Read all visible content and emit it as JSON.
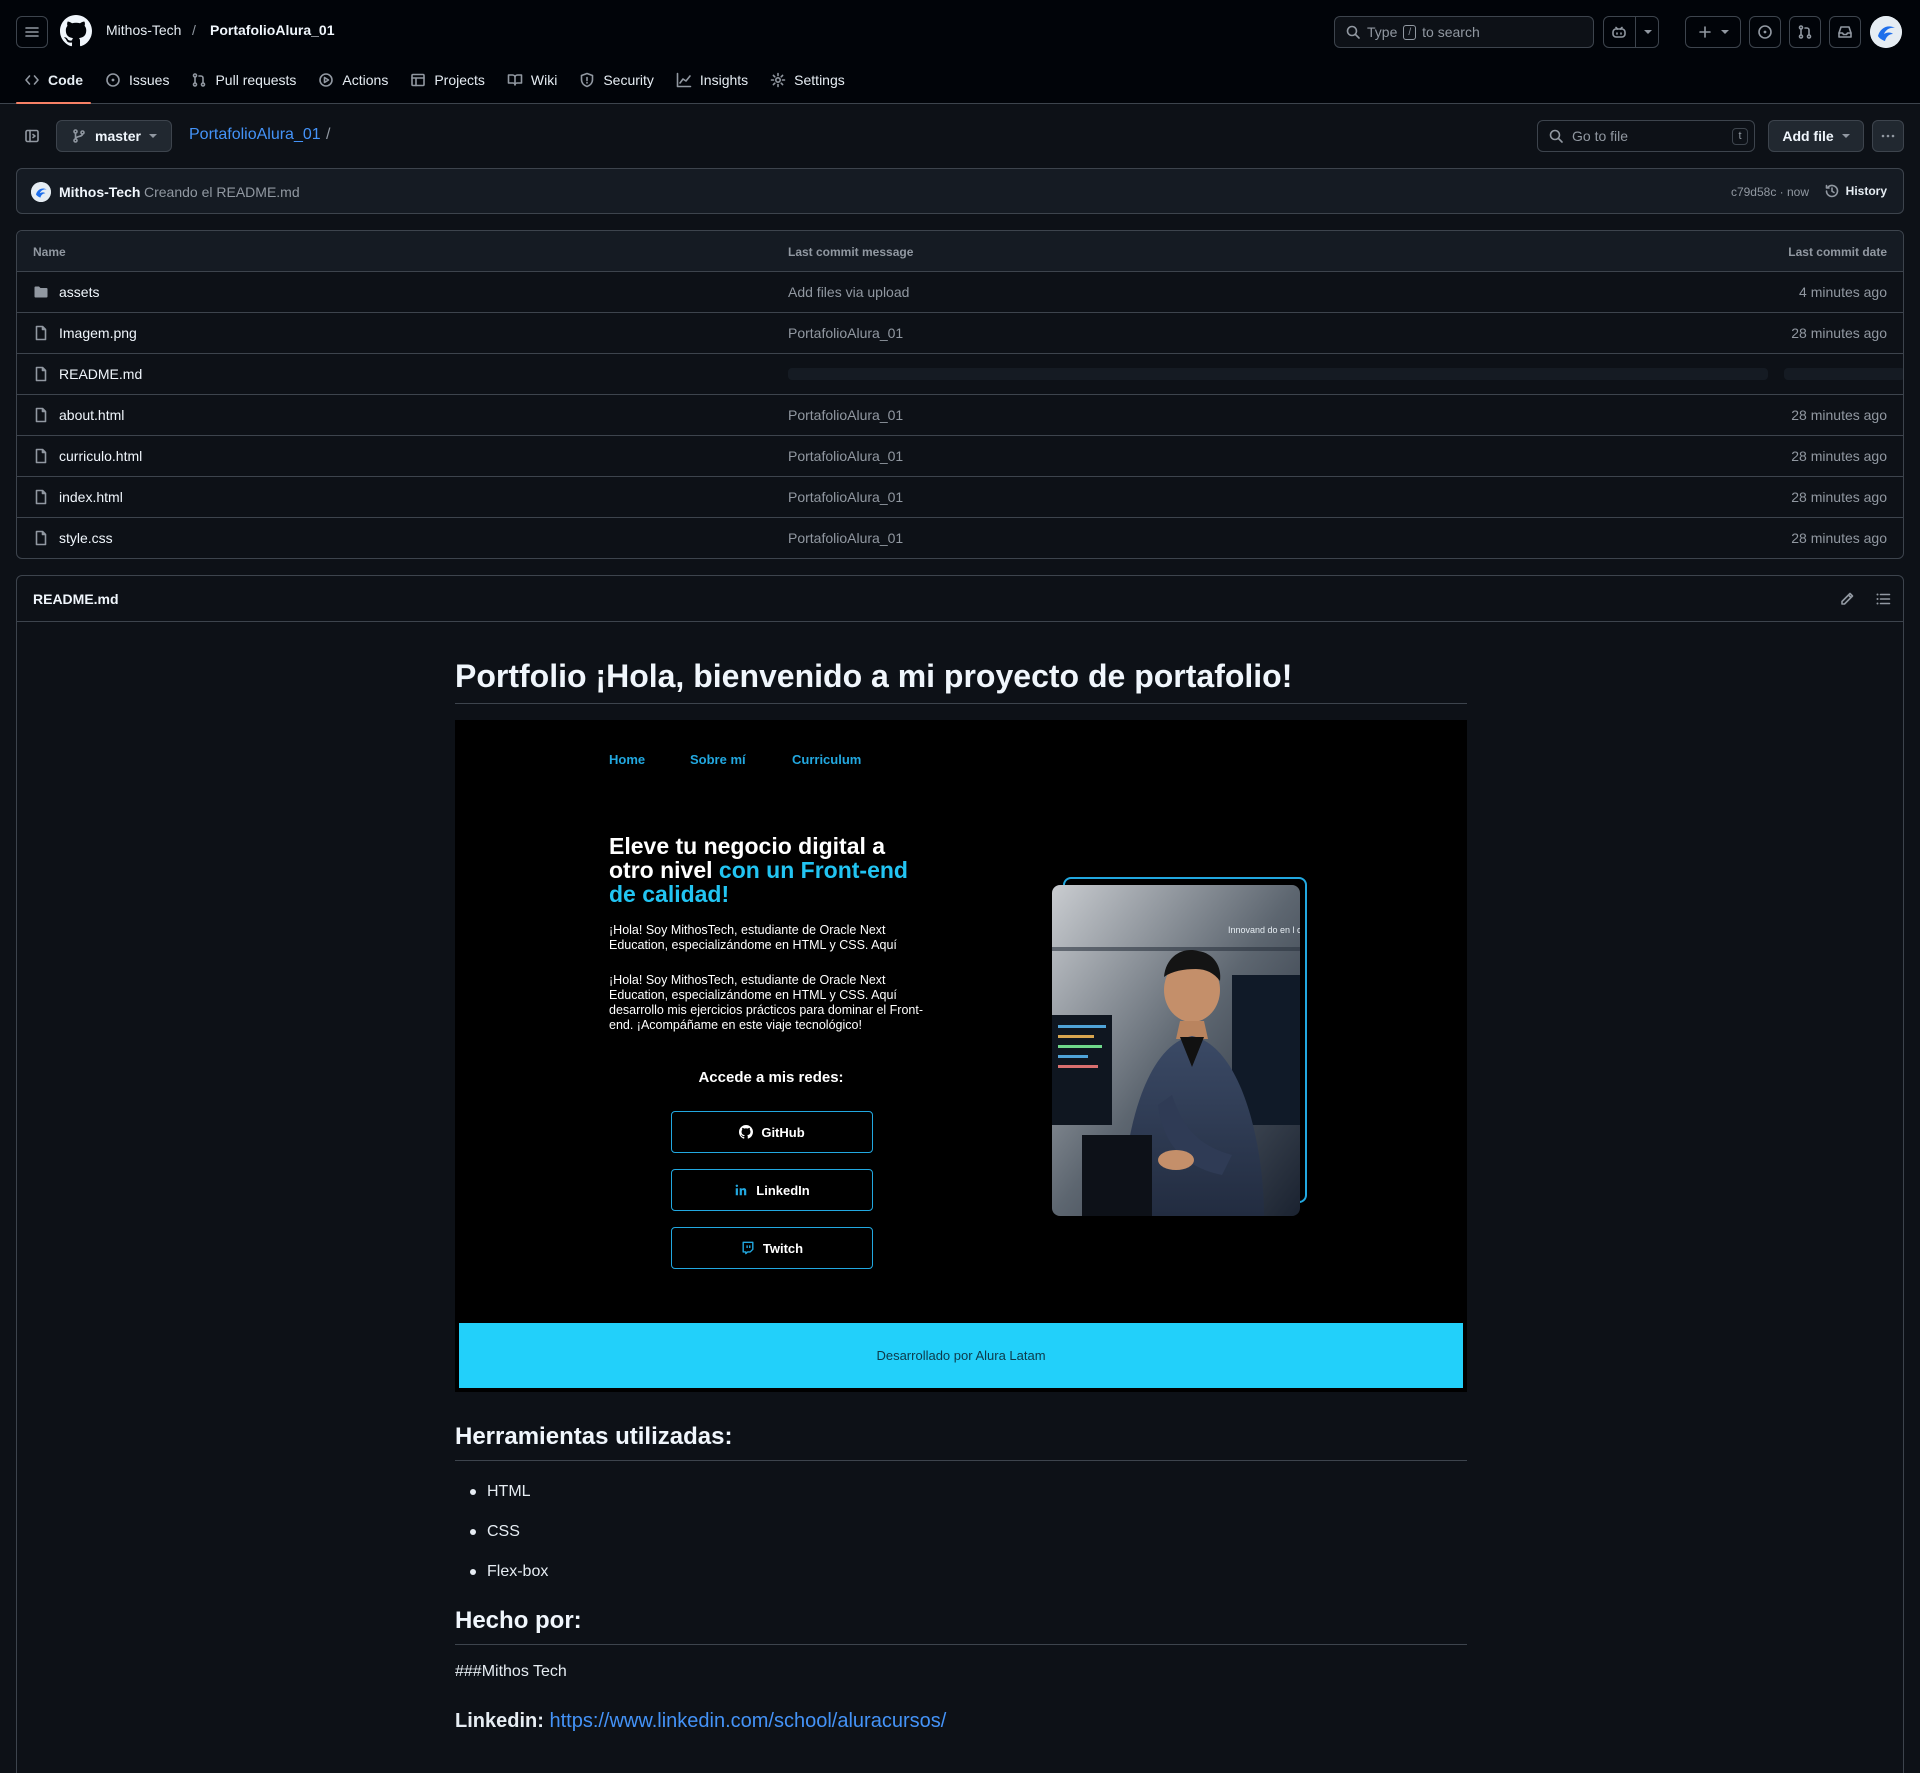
{
  "header": {
    "owner": "Mithos-Tech",
    "separator": "/",
    "repo": "PortafolioAlura_01",
    "search_before": "Type",
    "search_key": "/",
    "search_after": "to search"
  },
  "tabs": [
    {
      "label": "Code",
      "icon": "code-icon"
    },
    {
      "label": "Issues",
      "icon": "issue-icon"
    },
    {
      "label": "Pull requests",
      "icon": "pull-request-icon"
    },
    {
      "label": "Actions",
      "icon": "play-icon"
    },
    {
      "label": "Projects",
      "icon": "table-icon"
    },
    {
      "label": "Wiki",
      "icon": "book-icon"
    },
    {
      "label": "Security",
      "icon": "shield-icon"
    },
    {
      "label": "Insights",
      "icon": "graph-icon"
    },
    {
      "label": "Settings",
      "icon": "gear-icon"
    }
  ],
  "toolbar": {
    "branch": "master",
    "path_repo": "PortafolioAlura_01",
    "path_sep": "/",
    "goto_placeholder": "Go to file",
    "goto_key": "t",
    "add_file": "Add file"
  },
  "latest_commit": {
    "user": "Mithos-Tech",
    "message": "Creando el README.md",
    "hash_time": "c79d58c · now",
    "history": "History"
  },
  "files": {
    "headers": {
      "name": "Name",
      "message": "Last commit message",
      "date": "Last commit date"
    },
    "rows": [
      {
        "type": "folder",
        "name": "assets",
        "message": "Add files via upload",
        "date": "4 minutes ago"
      },
      {
        "type": "file",
        "name": "Imagem.png",
        "message": "PortafolioAlura_01",
        "date": "28 minutes ago"
      },
      {
        "type": "file",
        "name": "README.md",
        "message": "",
        "date": ""
      },
      {
        "type": "file",
        "name": "about.html",
        "message": "PortafolioAlura_01",
        "date": "28 minutes ago"
      },
      {
        "type": "file",
        "name": "curriculo.html",
        "message": "PortafolioAlura_01",
        "date": "28 minutes ago"
      },
      {
        "type": "file",
        "name": "index.html",
        "message": "PortafolioAlura_01",
        "date": "28 minutes ago"
      },
      {
        "type": "file",
        "name": "style.css",
        "message": "PortafolioAlura_01",
        "date": "28 minutes ago"
      }
    ]
  },
  "readme": {
    "filename": "README.md",
    "title": "Portfolio ¡Hola, bienvenido a mi proyecto de portafolio!",
    "screenshot": {
      "nav": [
        "Home",
        "Sobre mí",
        "Curriculum"
      ],
      "heading_1": "Eleve tu negocio digital a otro nivel",
      "heading_2": "con un Front-end de calidad!",
      "para_1": "¡Hola! Soy MithosTech, estudiante de Oracle Next Education, especializándome en HTML y CSS. Aquí",
      "para_2": "¡Hola! Soy MithosTech, estudiante de Oracle Next Education, especializándome en HTML y CSS. Aquí desarrollo mis ejercicios prácticos para dominar el Front-end. ¡Acompáñame en este viaje tecnológico!",
      "redes": "Accede a mis redes:",
      "buttons": [
        "GitHub",
        "LinkedIn",
        "Twitch"
      ],
      "photo_text": "Innovand do en l concle la Ge",
      "footer": "Desarrollado por Alura Latam"
    },
    "tools_heading": "Herramientas utilizadas:",
    "tools": [
      "HTML",
      "CSS",
      "Flex-box"
    ],
    "made_heading": "Hecho por:",
    "made_by": "###Mithos Tech",
    "linkedin_label": "Linkedin:",
    "linkedin_url": "https://www.linkedin.com/school/aluracursos/"
  },
  "colors": {
    "bg": "#0d1117",
    "topbar": "#010409",
    "border": "#3d444d",
    "link": "#4493f8",
    "tab_underline": "#f78166",
    "shot_accent": "#22a8e0",
    "shot_footer": "#22d0fa"
  }
}
